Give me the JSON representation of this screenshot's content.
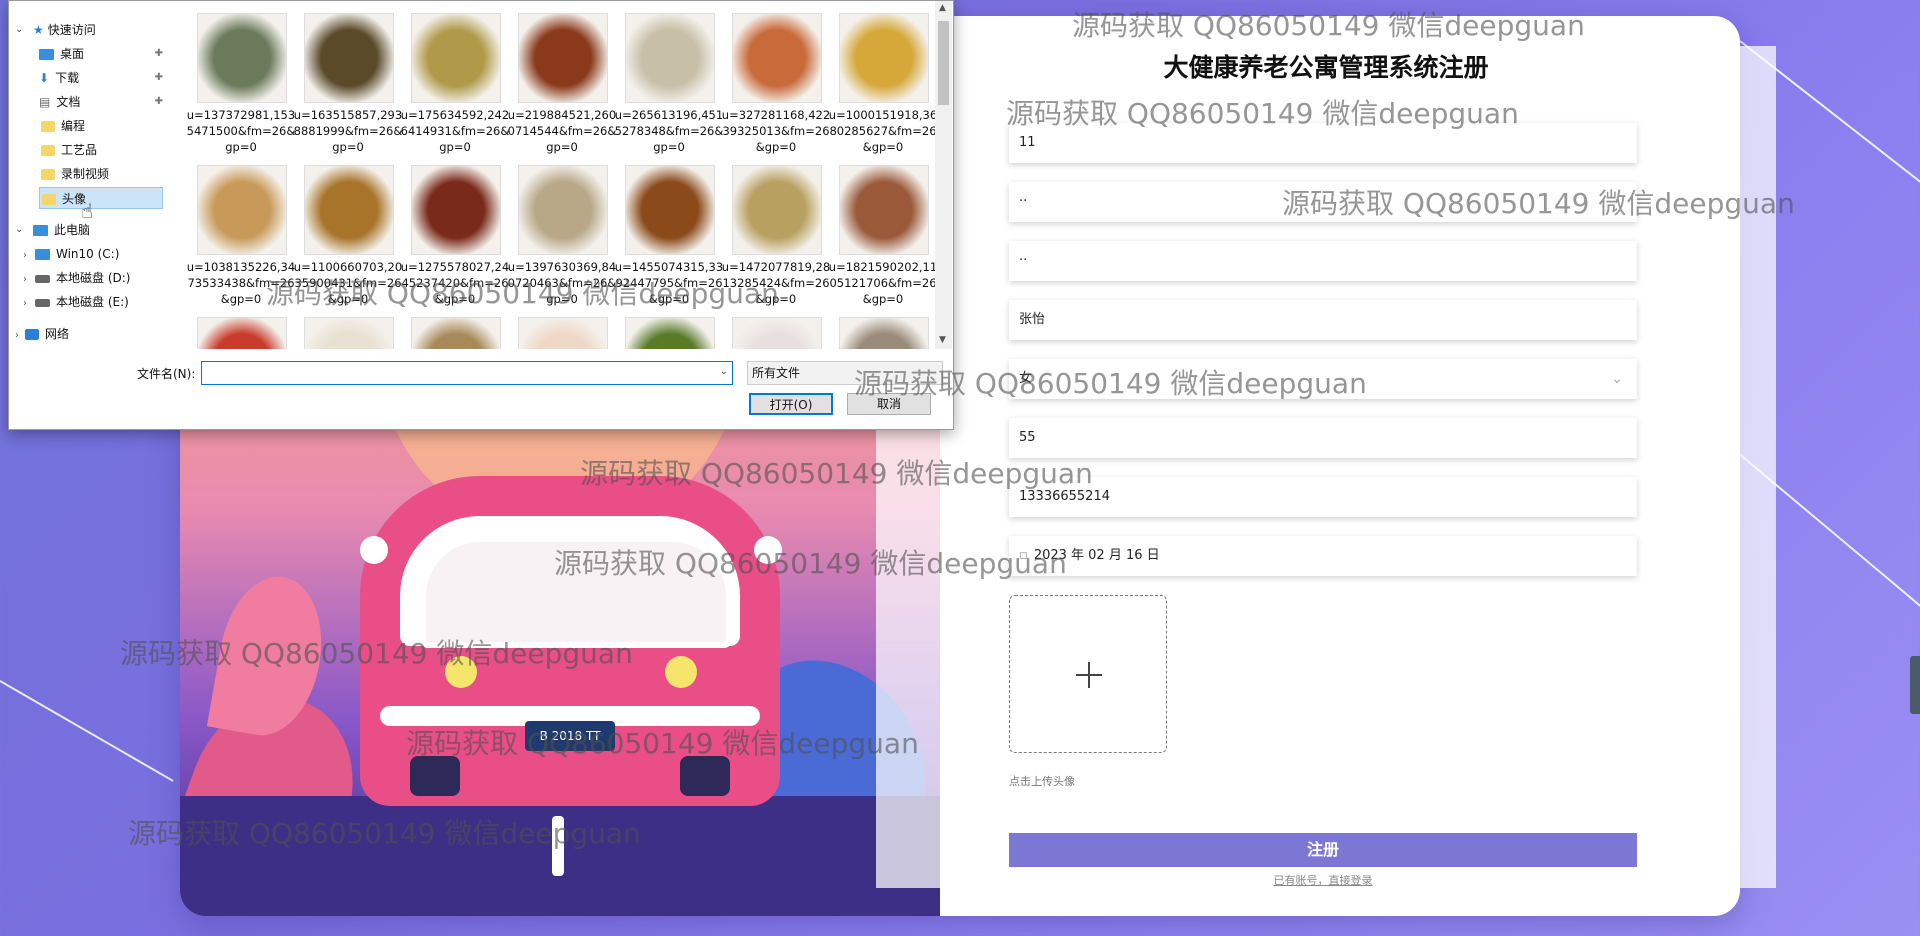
{
  "form": {
    "title": "大健康养老公寓管理系统注册",
    "fields": [
      {
        "name": "username",
        "value": "11"
      },
      {
        "name": "password",
        "value": "··"
      },
      {
        "name": "confirm-password",
        "value": "··"
      },
      {
        "name": "realname",
        "value": "张怡"
      },
      {
        "name": "gender",
        "value": "女"
      },
      {
        "name": "age",
        "value": "55"
      },
      {
        "name": "phone",
        "value": "13336655214"
      },
      {
        "name": "birthday",
        "value": "2023 年 02 月 16 日"
      }
    ],
    "upload_hint": "点击上传头像",
    "register_label": "注册",
    "login_link": "已有账号，直接登录"
  },
  "dialog": {
    "nav": {
      "quick_access": "快速访问",
      "desktop": "桌面",
      "downloads": "下载",
      "documents": "文档",
      "folder_programming": "编程",
      "folder_crafts": "工艺品",
      "folder_recordings": "录制视频",
      "folder_avatar": "头像",
      "this_pc": "此电脑",
      "drive_c": "Win10 (C:)",
      "drive_d": "本地磁盘 (D:)",
      "drive_e": "本地磁盘 (E:)",
      "network": "网络"
    },
    "files": [
      {
        "caption": "u=137372981,1535471500&fm=26&gp=0",
        "color": "#6a7a5a"
      },
      {
        "caption": "u=163515857,2938881999&fm=26&gp=0",
        "color": "#5a4a2a"
      },
      {
        "caption": "u=175634592,2426414931&fm=26&gp=0",
        "color": "#b09a4a"
      },
      {
        "caption": "u=219884521,2600714544&fm=26&gp=0",
        "color": "#8a3a1a"
      },
      {
        "caption": "u=265613196,4515278348&fm=26&gp=0",
        "color": "#c8bfa8"
      },
      {
        "caption": "u=327281168,42239325013&fm=26&gp=0",
        "color": "#c86a3a"
      },
      {
        "caption": "u=1000151918,3680285627&fm=26&gp=0",
        "color": "#d6a83a"
      },
      {
        "caption": "u=1038135226,3473533438&fm=26&gp=0",
        "color": "#c89a5a"
      },
      {
        "caption": "u=1100660703,2035900431&fm=26&gp=0",
        "color": "#a8742a"
      },
      {
        "caption": "u=1275578027,2445237420&fm=26&gp=0",
        "color": "#7a2a1a"
      },
      {
        "caption": "u=1397630369,840720463&fm=26&gp=0",
        "color": "#b8a888"
      },
      {
        "caption": "u=1455074315,3392447795&fm=26&gp=0",
        "color": "#8a4a1a"
      },
      {
        "caption": "u=1472077819,2813285424&fm=26&gp=0",
        "color": "#b8a060"
      },
      {
        "caption": "u=1821590202,1105121706&fm=26&gp=0",
        "color": "#9a5a3a"
      },
      {
        "caption": "",
        "color": "#c83a2a"
      },
      {
        "caption": "",
        "color": "#e8e0d0"
      },
      {
        "caption": "",
        "color": "#a88a5a"
      },
      {
        "caption": "",
        "color": "#f0d8c8"
      },
      {
        "caption": "",
        "color": "#5a7a2a"
      },
      {
        "caption": "",
        "color": "#e8e0e0"
      },
      {
        "caption": "",
        "color": "#9a8a7a"
      }
    ],
    "filename_label": "文件名(N):",
    "filename_value": "",
    "filetype": "所有文件",
    "open_label": "打开(O)",
    "cancel_label": "取消"
  },
  "watermark": "源码获取 QQ86050149 微信deepguan"
}
